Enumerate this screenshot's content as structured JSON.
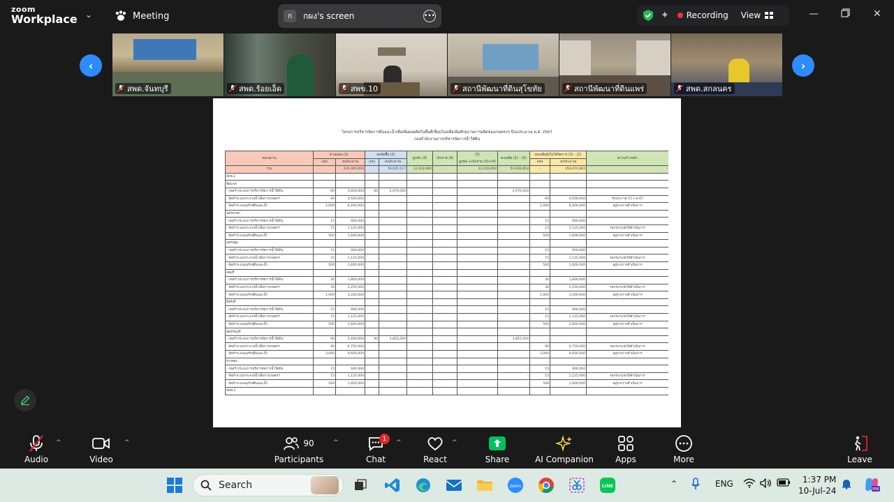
{
  "app": {
    "logo_line1": "zoom",
    "logo_line2": "Workplace",
    "meeting_label": "Meeting",
    "screen_share_avatar": "ก",
    "screen_share_label": "กผง's screen",
    "recording_label": "Recording",
    "view_label": "View"
  },
  "participants_strip": [
    {
      "name": "สพด.จันทบุรี"
    },
    {
      "name": "สพด.ร้อยเอ็ด"
    },
    {
      "name": "สพข.10"
    },
    {
      "name": "สถานีพัฒนาที่ดินสุโขทัย"
    },
    {
      "name": "สถานีพัฒนาที่ดินแพร่"
    },
    {
      "name": "สพด.สกลนคร"
    }
  ],
  "document": {
    "title": "โครงการบริหารจัดการดินและน้ำเพื่อเพิ่มผลผลิตในพื้นที่เชื่อมโยงเพื่อเพิ่มศักยภาพการผลิตของเกษตรกร ปีงบประมาณ พ.ศ. 2567",
    "subtitle": "กองสำนักงานการบริหารจัดการน้ำใต้ดิน",
    "headers": {
      "unit": "หน่วยงาน",
      "plan": "ตามแผน (1)",
      "contract": "ผลจัดซื้อ (2)",
      "bind": "ผูกพัน (3)",
      "disb": "เบิกจ่าย (4)",
      "col5": "(5)",
      "col5b": "ผูกพัน +เบิกจ่าย (3)+(4)",
      "remain": "คงเหลือ (2) – (5)",
      "notdone": "คงเหลือยังไม่ได้จัดการ (1) - (2)",
      "progress": "ความก้าวหน้า",
      "qty": "แห่ง",
      "budget": "งบประมาณ"
    },
    "total": {
      "label": "รวม",
      "plan_budget": "435,000,000",
      "contract_budget": "78,025,117",
      "bind": "12,102,600",
      "disb": "-",
      "sum": "12,102,600",
      "remain": "51,602,854",
      "notdone_qty": "-",
      "notdone_budget": "356,974,883",
      "progress": "-"
    },
    "rows": [
      {
        "t": "sec",
        "label": "สพข.1"
      },
      {
        "t": "sec",
        "label": "ชัยนาท"
      },
      {
        "t": "row",
        "label": "- ก่อสร้างระบบการบริหารจัดการน้ำใต้ดิน",
        "q": "60",
        "b": "3,600,000",
        "cq": "60",
        "cb": "2,970,000",
        "bind": "",
        "disb": "",
        "sum": "",
        "rem": "2,970,000",
        "nq": "-",
        "nb": "",
        "p": ""
      },
      {
        "t": "row",
        "label": "- จัดทำระบบกระจายน้ำเพื่อการเกษตรฯ",
        "q": "60",
        "b": "4,500,000",
        "cq": "",
        "cb": "",
        "bind": "",
        "disb": "",
        "sum": "",
        "rem": "-",
        "nq": "60",
        "nb": "4,500,000",
        "p": "รับประกาศ 15 ก.ค.67"
      },
      {
        "t": "row",
        "label": "- จัดทำระบบอนุรักษ์ดินและน้ำ",
        "q": "2,000",
        "b": "6,400,000",
        "cq": "",
        "cb": "",
        "bind": "",
        "disb": "",
        "sum": "",
        "rem": "-",
        "nq": "2,000",
        "nb": "6,400,000",
        "p": "อยู่ระหว่างดำเนินการ"
      },
      {
        "t": "sec",
        "label": "นครนายก"
      },
      {
        "t": "row",
        "label": "- ก่อสร้างระบบการบริหารจัดการน้ำใต้ดิน",
        "q": "15",
        "b": "900,000",
        "cq": "",
        "cb": "",
        "bind": "",
        "disb": "",
        "sum": "",
        "rem": "-",
        "nq": "15",
        "nb": "900,000",
        "p": ""
      },
      {
        "t": "row",
        "label": "- จัดทำระบบกระจายน้ำเพื่อการเกษตรฯ",
        "q": "15",
        "b": "1,125,000",
        "cq": "",
        "cb": "",
        "bind": "",
        "disb": "",
        "sum": "",
        "rem": "-",
        "nq": "15",
        "nb": "1,125,000",
        "p": "รอกรมฯแจ้งให้ดำเนินการ"
      },
      {
        "t": "row",
        "label": "- จัดทำระบบอนุรักษ์ดินและน้ำ",
        "q": "500",
        "b": "1,600,000",
        "cq": "",
        "cb": "",
        "bind": "",
        "disb": "",
        "sum": "",
        "rem": "-",
        "nq": "500",
        "nb": "1,600,000",
        "p": "อยู่ระหว่างดำเนินการ"
      },
      {
        "t": "sec",
        "label": "นครปฐม"
      },
      {
        "t": "row",
        "label": "- ก่อสร้างระบบการบริหารจัดการน้ำใต้ดิน",
        "q": "15",
        "b": "900,000",
        "cq": "",
        "cb": "",
        "bind": "",
        "disb": "",
        "sum": "",
        "rem": "-",
        "nq": "15",
        "nb": "900,000",
        "p": ""
      },
      {
        "t": "row",
        "label": "- จัดทำระบบกระจายน้ำเพื่อการเกษตรฯ",
        "q": "15",
        "b": "1,125,000",
        "cq": "",
        "cb": "",
        "bind": "",
        "disb": "",
        "sum": "",
        "rem": "-",
        "nq": "15",
        "nb": "1,125,000",
        "p": "รอกรมฯแจ้งให้ดำเนินการ"
      },
      {
        "t": "row",
        "label": "- จัดทำระบบอนุรักษ์ดินและน้ำ",
        "q": "500",
        "b": "1,600,000",
        "cq": "",
        "cb": "",
        "bind": "",
        "disb": "",
        "sum": "",
        "rem": "-",
        "nq": "500",
        "nb": "1,600,000",
        "p": "อยู่ระหว่างดำเนินการ"
      },
      {
        "t": "sec",
        "label": "ลพบุรี"
      },
      {
        "t": "row",
        "label": "- ก่อสร้างระบบการบริหารจัดการน้ำใต้ดิน",
        "q": "30",
        "b": "1,800,000",
        "cq": "",
        "cb": "",
        "bind": "",
        "disb": "",
        "sum": "",
        "rem": "-",
        "nq": "30",
        "nb": "1,800,000",
        "p": ""
      },
      {
        "t": "row",
        "label": "- จัดทำระบบกระจายน้ำเพื่อการเกษตรฯ",
        "q": "30",
        "b": "2,250,000",
        "cq": "",
        "cb": "",
        "bind": "",
        "disb": "",
        "sum": "",
        "rem": "-",
        "nq": "30",
        "nb": "2,250,000",
        "p": "รอกรมฯแจ้งให้ดำเนินการ"
      },
      {
        "t": "row",
        "label": "- จัดทำระบบอนุรักษ์ดินและน้ำ",
        "q": "1,000",
        "b": "3,200,000",
        "cq": "",
        "cb": "",
        "bind": "",
        "disb": "",
        "sum": "",
        "rem": "-",
        "nq": "1,000",
        "nb": "3,200,000",
        "p": "อยู่ระหว่างดำเนินการ"
      },
      {
        "t": "sec",
        "label": "สิงห์บุรี"
      },
      {
        "t": "row",
        "label": "- ก่อสร้างระบบการบริหารจัดการน้ำใต้ดิน",
        "q": "15",
        "b": "900,000",
        "cq": "",
        "cb": "",
        "bind": "",
        "disb": "",
        "sum": "",
        "rem": "-",
        "nq": "15",
        "nb": "900,000",
        "p": ""
      },
      {
        "t": "row",
        "label": "- จัดทำระบบกระจายน้ำเพื่อการเกษตรฯ",
        "q": "15",
        "b": "1,125,000",
        "cq": "",
        "cb": "",
        "bind": "",
        "disb": "",
        "sum": "",
        "rem": "-",
        "nq": "15",
        "nb": "1,125,000",
        "p": "รอกรมฯแจ้งให้ดำเนินการ"
      },
      {
        "t": "row",
        "label": "- จัดทำระบบอนุรักษ์ดินและน้ำ",
        "q": "500",
        "b": "1,600,000",
        "cq": "",
        "cb": "",
        "bind": "",
        "disb": "",
        "sum": "",
        "rem": "-",
        "nq": "500",
        "nb": "1,600,000",
        "p": "อยู่ระหว่างดำเนินการ"
      },
      {
        "t": "sec",
        "label": "สุพรรณบุรี"
      },
      {
        "t": "row",
        "label": "- ก่อสร้างระบบการบริหารจัดการน้ำใต้ดิน",
        "q": "90",
        "b": "5,400,000",
        "cq": "90",
        "cb": "3,852,000",
        "bind": "",
        "disb": "",
        "sum": "",
        "rem": "3,852,000",
        "nq": "-",
        "nb": "",
        "p": ""
      },
      {
        "t": "row",
        "label": "- จัดทำระบบกระจายน้ำเพื่อการเกษตรฯ",
        "q": "90",
        "b": "6,750,000",
        "cq": "",
        "cb": "",
        "bind": "",
        "disb": "",
        "sum": "",
        "rem": "-",
        "nq": "90",
        "nb": "6,750,000",
        "p": "รอกรมฯแจ้งให้ดำเนินการ"
      },
      {
        "t": "row",
        "label": "- จัดทำระบบอนุรักษ์ดินและน้ำ",
        "q": "3,000",
        "b": "9,600,000",
        "cq": "",
        "cb": "",
        "bind": "",
        "disb": "",
        "sum": "",
        "rem": "-",
        "nq": "3,000",
        "nb": "9,600,000",
        "p": "อยู่ระหว่างดำเนินการ"
      },
      {
        "t": "sec",
        "label": "อ่างทอง"
      },
      {
        "t": "row",
        "label": "- ก่อสร้างระบบการบริหารจัดการน้ำใต้ดิน",
        "q": "15",
        "b": "900,000",
        "cq": "",
        "cb": "",
        "bind": "",
        "disb": "",
        "sum": "",
        "rem": "-",
        "nq": "15",
        "nb": "900,000",
        "p": ""
      },
      {
        "t": "row",
        "label": "- จัดทำระบบกระจายน้ำเพื่อการเกษตรฯ",
        "q": "15",
        "b": "1,125,000",
        "cq": "",
        "cb": "",
        "bind": "",
        "disb": "",
        "sum": "",
        "rem": "-",
        "nq": "15",
        "nb": "1,125,000",
        "p": "รอกรมฯแจ้งให้ดำเนินการ"
      },
      {
        "t": "row",
        "label": "- จัดทำระบบอนุรักษ์ดินและน้ำ",
        "q": "500",
        "b": "1,600,000",
        "cq": "",
        "cb": "",
        "bind": "",
        "disb": "",
        "sum": "",
        "rem": "-",
        "nq": "500",
        "nb": "1,600,000",
        "p": "อยู่ระหว่างดำเนินการ"
      },
      {
        "t": "sec",
        "label": "สพข.2"
      }
    ]
  },
  "toolbar": {
    "audio": "Audio",
    "video": "Video",
    "participants": "Participants",
    "participants_count": "90",
    "chat": "Chat",
    "chat_badge": "1",
    "react": "React",
    "share": "Share",
    "ai": "AI Companion",
    "apps": "Apps",
    "more": "More",
    "leave": "Leave"
  },
  "taskbar": {
    "search_placeholder": "Search",
    "lang": "ENG",
    "time": "1:37 PM",
    "date": "10-Jul-24"
  },
  "colors": {
    "accent": "#2d8cff",
    "recording": "#e8363d",
    "share_green": "#00c15e",
    "leave_red": "#e02828"
  }
}
